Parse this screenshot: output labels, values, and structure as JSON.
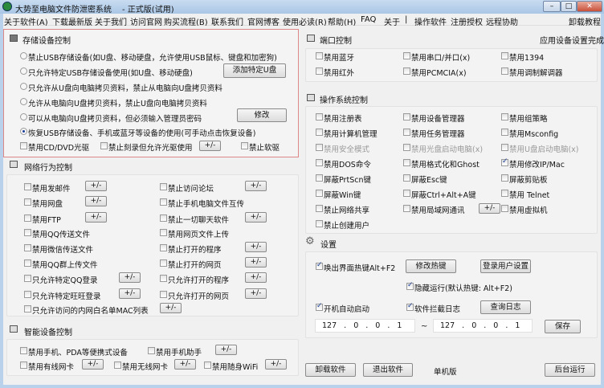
{
  "window": {
    "title": "大势至电脑文件防泄密系统",
    "edition": "- 正式版(试用)",
    "minimize": "–",
    "maximize": "□",
    "close": "✕"
  },
  "menu": [
    "关于软件(A)",
    "下载最新版",
    "关于我们",
    "访问官网",
    "购买流程(B)",
    "联系我们",
    "官网博客",
    "使用必读(R)",
    "帮助(H)",
    "FAQ",
    "关于",
    "|",
    "操作软件",
    "注册授权",
    "远程协助",
    "卸载教程"
  ],
  "storage": {
    "title": "存储设备控制",
    "options": [
      "禁止USB存储设备(如U盘、移动硬盘，允许使用USB鼠标、键盘和加密狗)",
      "只允许特定USB存储设备使用(如U盘、移动硬盘)",
      "只允许从U盘向电脑拷贝资料，禁止从电脑向U盘拷贝资料",
      "允许从电脑向U盘拷贝资料，禁止U盘向电脑拷贝资料",
      "可以从电脑向U盘拷贝资料，但必须输入管理员密码",
      "恢复USB存储设备、手机或蓝牙等设备的使用(可手动点击恢复设备)"
    ],
    "selected_index": 5,
    "add_usb": "添加特定U盘",
    "modify": "修改",
    "cd": "禁用CD/DVD光驱",
    "burn": "禁止刻录但允许光驱使用",
    "pm": "+/-",
    "floppy": "禁止软驱"
  },
  "network": {
    "title": "网络行为控制",
    "left": [
      "禁用发邮件",
      "禁用网盘",
      "禁用FTP",
      "禁用QQ传送文件",
      "禁用微信传送文件",
      "禁用QQ群上传文件",
      "只允许特定QQ登录",
      "只允许特定旺旺登录",
      "只允许访问的内网白名单MAC列表"
    ],
    "right": [
      "禁止访问论坛",
      "禁止手机电脑文件互传",
      "禁止一切聊天软件",
      "禁用网页文件上传",
      "禁止打开的程序",
      "禁止打开的网页",
      "只允许打开的程序",
      "只允许打开的网页"
    ],
    "pm": "+/-"
  },
  "smart": {
    "title": "智能设备控制",
    "items": [
      "禁用手机、PDA等便携式设备",
      "禁用手机助手",
      "禁用有线网卡",
      "禁用无线网卡",
      "禁用随身WiFi"
    ],
    "pm": "+/-"
  },
  "port": {
    "title": "端口控制",
    "status": "应用设备设置完成",
    "items": [
      "禁用蓝牙",
      "禁用串口/并口(x)",
      "禁用1394",
      "禁用红外",
      "禁用PCMCIA(x)",
      "禁用调制解调器"
    ]
  },
  "os": {
    "title": "操作系统控制",
    "items": [
      "禁用注册表",
      "禁用设备管理器",
      "禁用组策略",
      "禁用计算机管理",
      "禁用任务管理器",
      "禁用Msconfig",
      "禁用安全模式",
      "禁用光盘启动电脑(x)",
      "禁用U盘启动电脑(x)",
      "禁用DOS命令",
      "禁用格式化和Ghost",
      "禁用修改IP/Mac",
      "屏蔽PrtScn键",
      "屏蔽Esc键",
      "屏蔽剪贴板",
      "屏蔽Win键",
      "屏蔽Ctrl+Alt+A键",
      "禁用 Telnet",
      "禁止网络共享",
      "禁用局域网通讯",
      "禁用虚拟机",
      "禁止创建用户"
    ],
    "pm": "+/-"
  },
  "settings": {
    "title": "设置",
    "hotkey": "唤出界面热键Alt+F2",
    "modify_hotkey": "修改热键",
    "login_user": "登录用户设置",
    "hide_run": "隐藏运行(默认热键: Alt+F2)",
    "autostart": "开机自动启动",
    "intercept_log": "软件拦截日志",
    "query_log": "查询日志",
    "ip_from": "127 . 0 . 0 . 1",
    "tilde": "~",
    "ip_to": "127 . 0 . 0 . 1",
    "save": "保存"
  },
  "footer": {
    "uninstall": "卸载软件",
    "exit": "退出软件",
    "version": "单机版",
    "background": "后台运行"
  }
}
